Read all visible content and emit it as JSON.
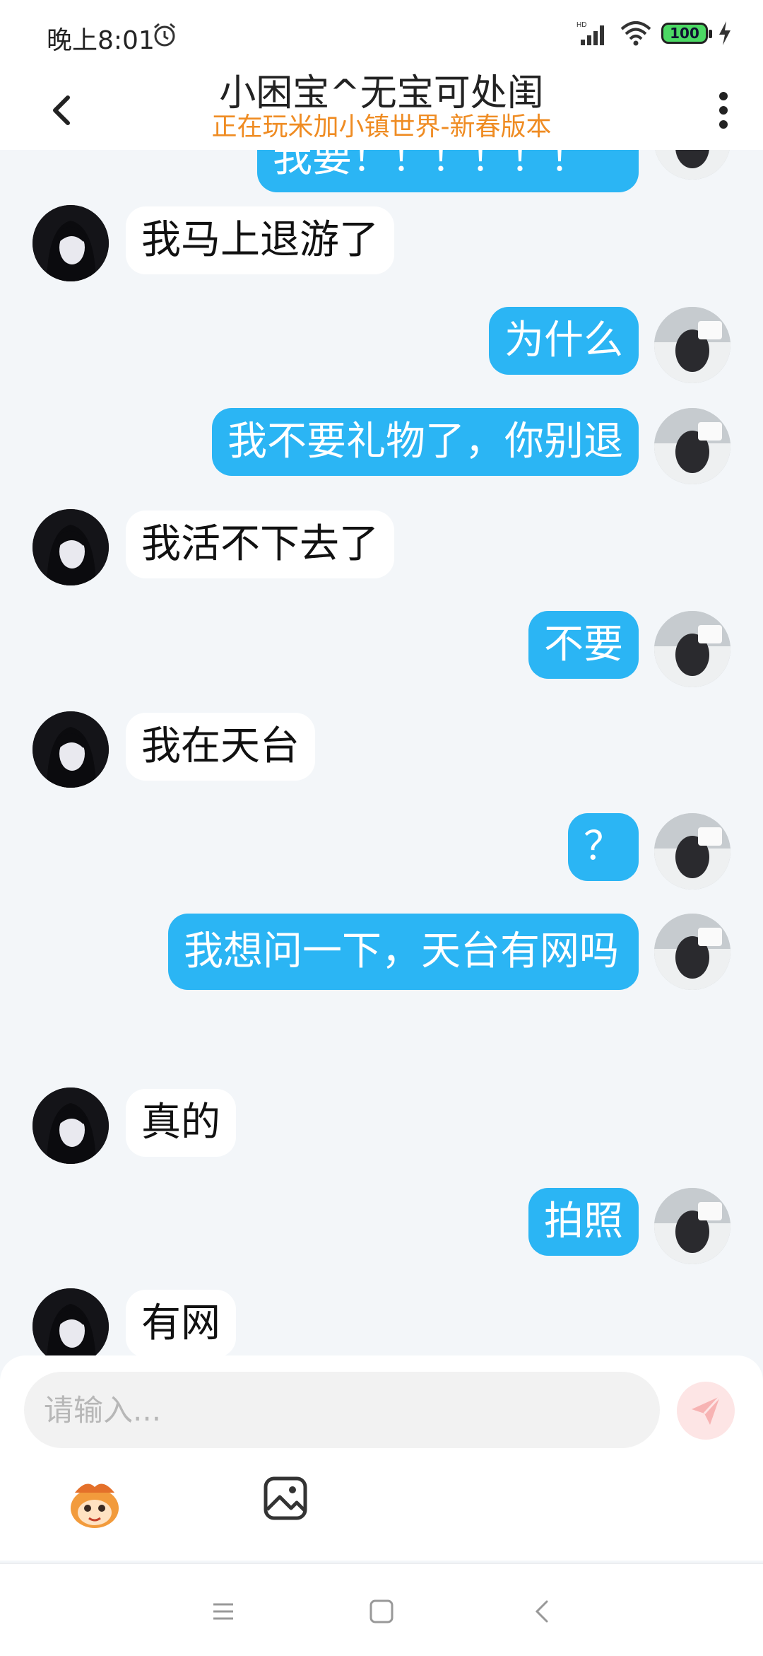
{
  "status_bar": {
    "time": "晚上8:01",
    "battery": "100",
    "icons": [
      "alarm-icon",
      "hd-signal-icon",
      "wifi-icon",
      "battery-icon",
      "charging-icon"
    ]
  },
  "header": {
    "title": "小困宝^无宝可处闺",
    "subtitle": "正在玩米加小镇世界-新春版本",
    "subtitle_color": "#ef8c23"
  },
  "messages": [
    {
      "side": "me",
      "text": "我要！！！！！！"
    },
    {
      "side": "other",
      "text": "我马上退游了"
    },
    {
      "side": "me",
      "text": "为什么"
    },
    {
      "side": "me",
      "text": "我不要礼物了，你别退"
    },
    {
      "side": "other",
      "text": "我活不下去了"
    },
    {
      "side": "me",
      "text": "不要"
    },
    {
      "side": "other",
      "text": "我在天台"
    },
    {
      "side": "me",
      "text": "？"
    },
    {
      "side": "me",
      "text": "我想问一下，天台有网吗"
    },
    {
      "side": "other",
      "text": "真的"
    },
    {
      "side": "me",
      "text": "拍照"
    },
    {
      "side": "other",
      "text": "有网"
    }
  ],
  "input": {
    "placeholder": "请输入..."
  },
  "toolbar": [
    "emoji-icon",
    "image-icon",
    "send-icon"
  ],
  "colors": {
    "my_bubble": "#2bb5f4",
    "other_bubble": "#ffffff",
    "chat_background": "#f3f6f9"
  }
}
